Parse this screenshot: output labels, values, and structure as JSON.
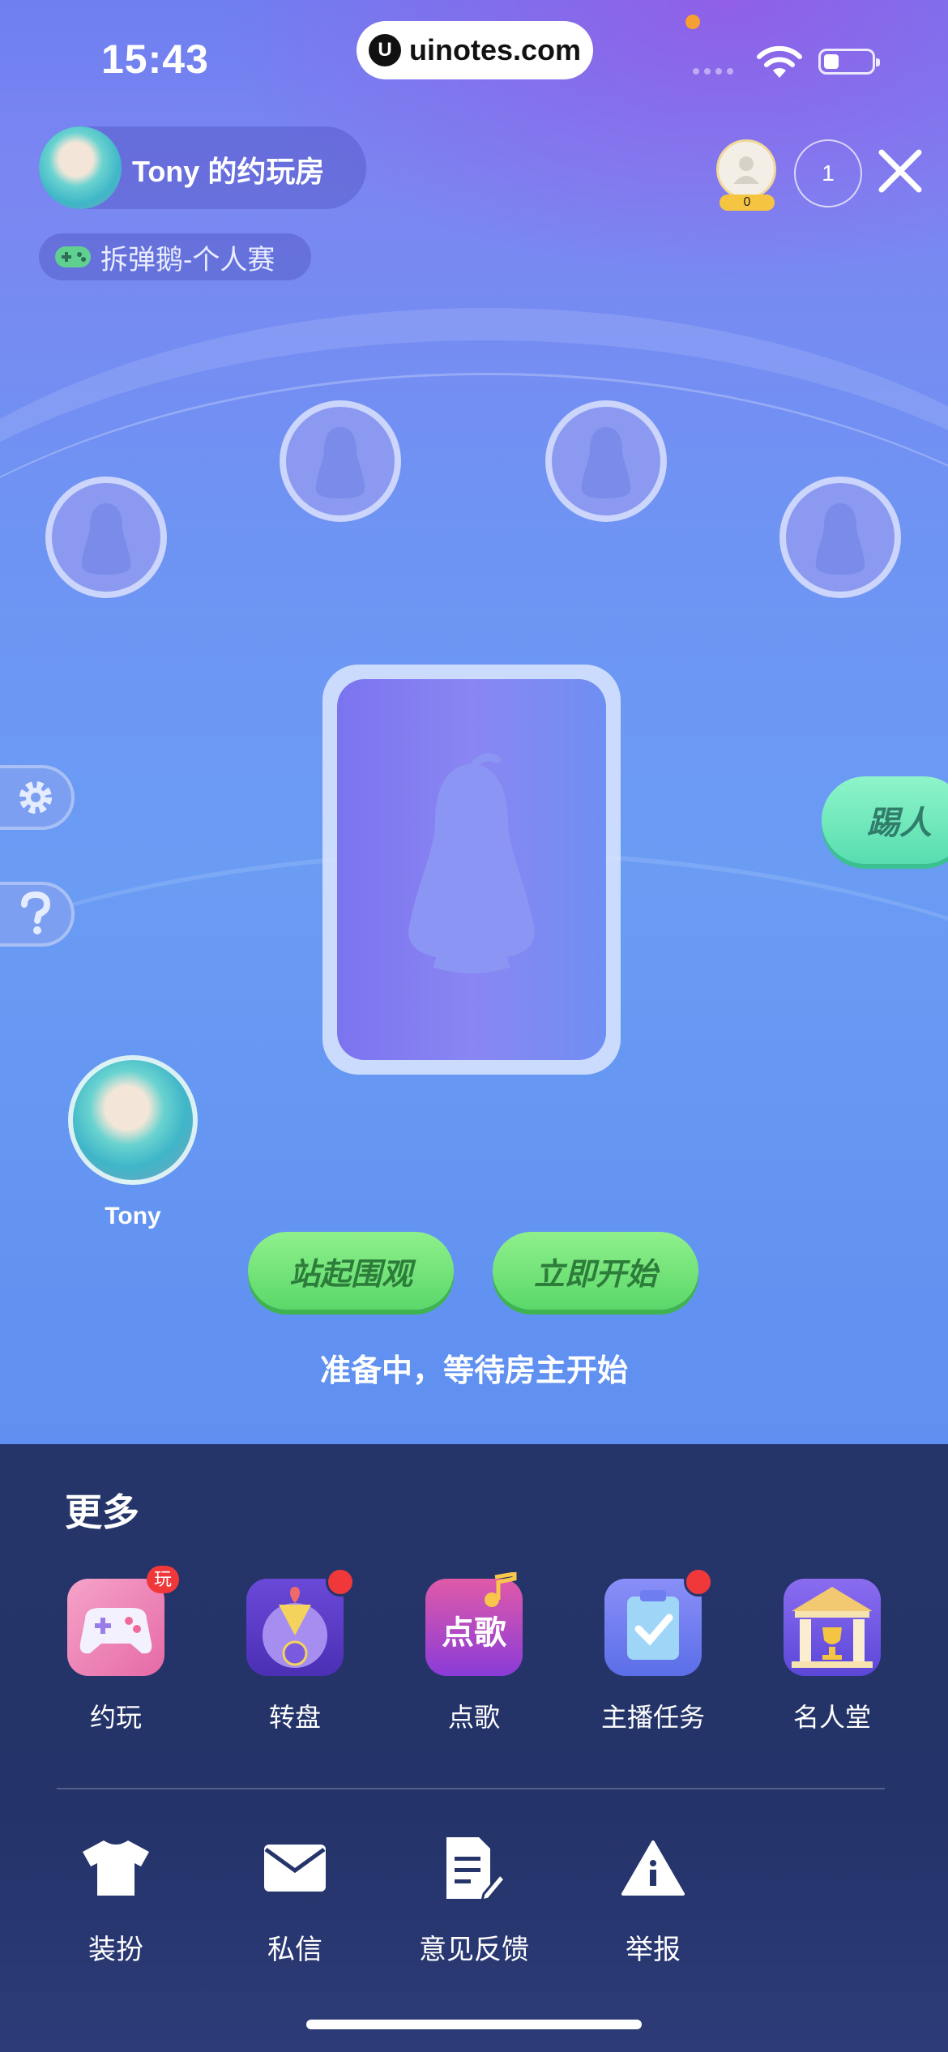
{
  "status_bar": {
    "time": "15:43",
    "watermark": "uinotes.com"
  },
  "room": {
    "title": "Tony 的约玩房",
    "game": "拆弹鹅-个人赛",
    "viewer_count": "0",
    "online_count": "1"
  },
  "player": {
    "name": "Tony"
  },
  "buttons": {
    "kick": "踢人",
    "stand_watch": "站起围观",
    "start_now": "立即开始"
  },
  "status_text": "准备中，等待房主开始",
  "more": {
    "title": "更多",
    "apps": [
      {
        "label": "约玩",
        "icon": "gamepad-icon",
        "badge": "玩"
      },
      {
        "label": "转盘",
        "icon": "wheel-icon",
        "badge": "dot"
      },
      {
        "label": "点歌",
        "icon": "song-request-icon",
        "icon_text": "点歌"
      },
      {
        "label": "主播任务",
        "icon": "task-icon",
        "badge": "dot"
      },
      {
        "label": "名人堂",
        "icon": "hall-of-fame-icon"
      }
    ],
    "tools": [
      {
        "label": "装扮",
        "icon": "tshirt-icon"
      },
      {
        "label": "私信",
        "icon": "mail-icon"
      },
      {
        "label": "意见反馈",
        "icon": "feedback-icon"
      },
      {
        "label": "举报",
        "icon": "warning-icon"
      }
    ]
  },
  "colors": {
    "accent_green": "#5bd86a",
    "kick_green": "#58ddb0",
    "badge_red": "#f0383b",
    "sheet_bg": "#253569"
  }
}
